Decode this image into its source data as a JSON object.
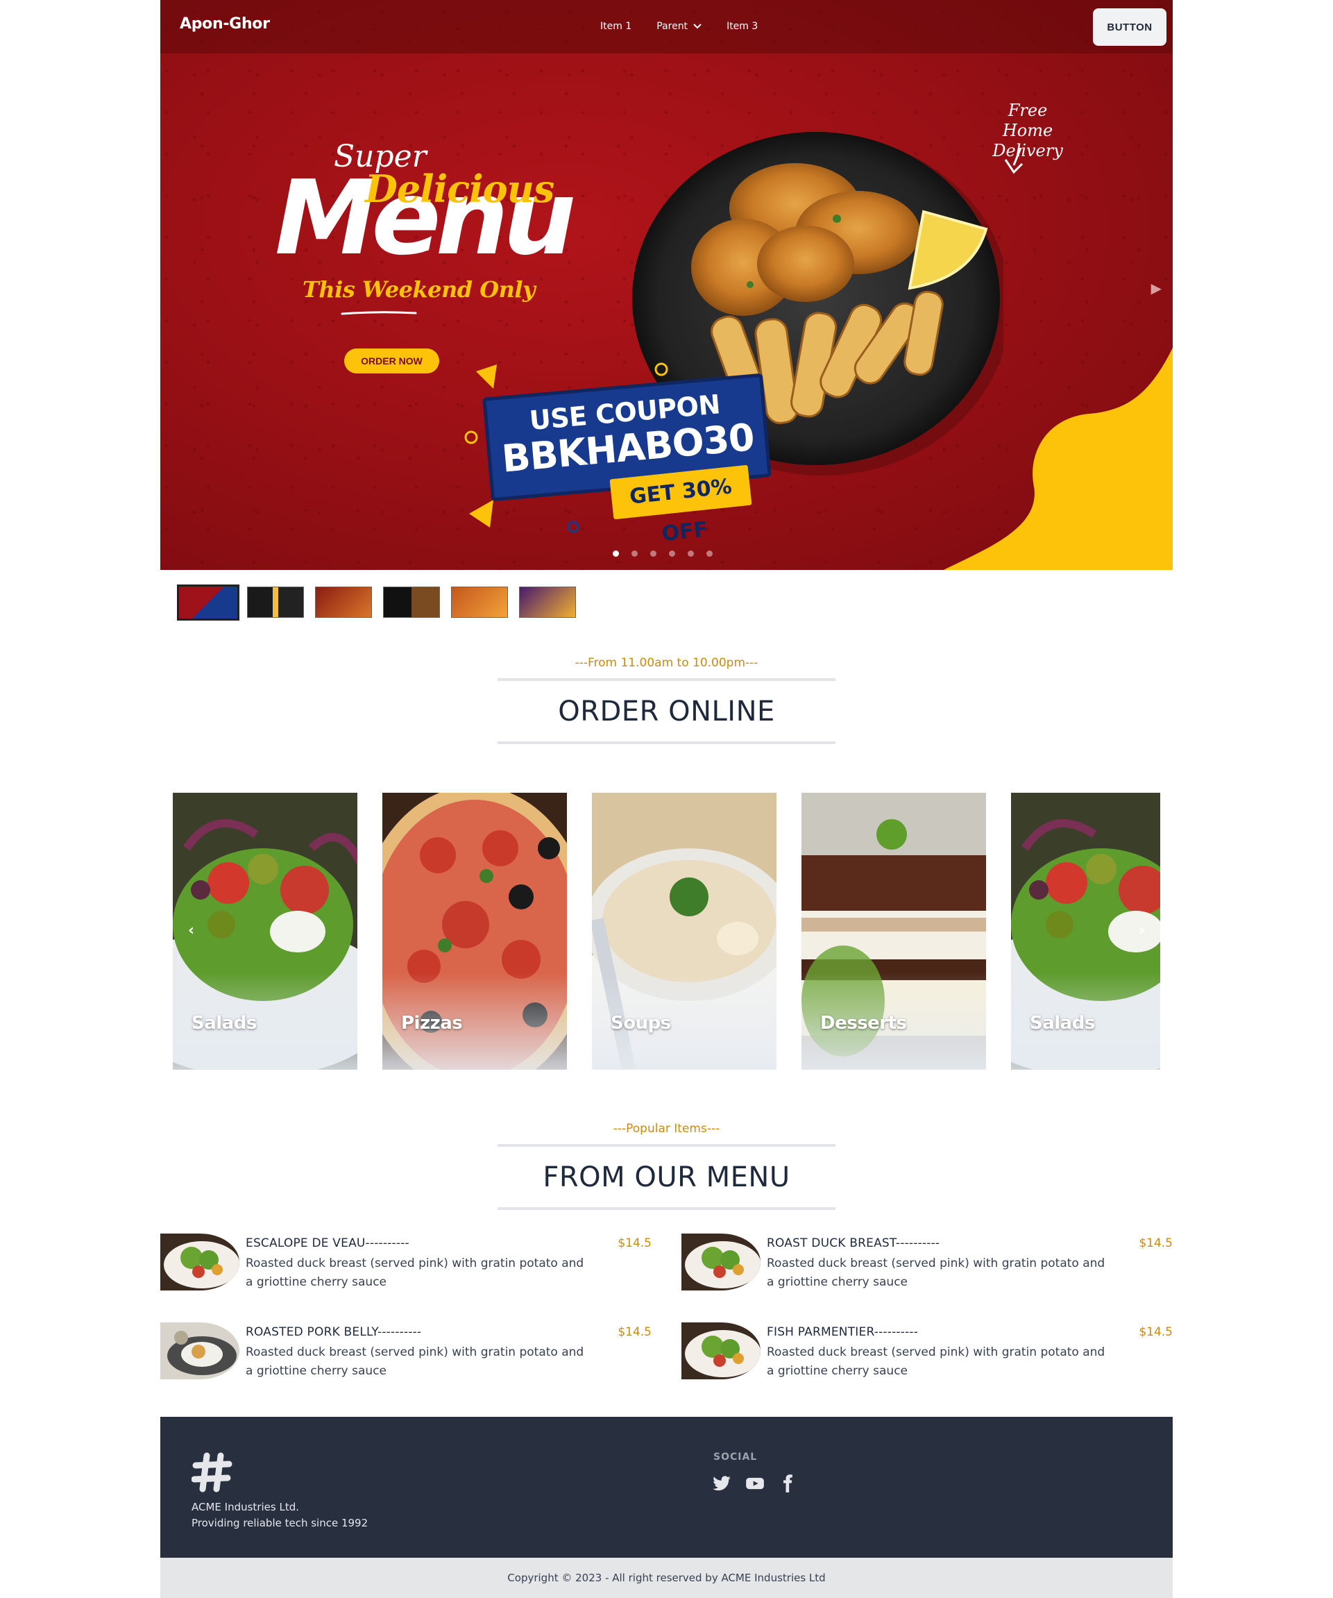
{
  "nav": {
    "brand": "Apon-Ghor",
    "items": [
      {
        "label": "Item 1"
      },
      {
        "label": "Parent"
      },
      {
        "label": "Item 3"
      }
    ],
    "button_label": "BUTTON"
  },
  "hero": {
    "super": "Super",
    "delicious": "Delicious",
    "menu": "Menu",
    "weekend": "This Weekend Only",
    "order_now": "ORDER NOW",
    "free_delivery_line1": "Free Home",
    "free_delivery_line2": "Delivery",
    "coupon_line1": "USE COUPON",
    "coupon_code": "BBKHABO30",
    "coupon_off": "GET 30% OFF",
    "slide_count": 6,
    "active_slide": 1
  },
  "order_section": {
    "sub_label": "---From 11.00am to 10.00pm---",
    "title": "ORDER ONLINE"
  },
  "categories": [
    {
      "label": "Salads"
    },
    {
      "label": "Pizzas"
    },
    {
      "label": "Soups"
    },
    {
      "label": "Desserts"
    },
    {
      "label": "Salads"
    }
  ],
  "menu_section": {
    "sub_label": "---Popular Items---",
    "title": "FROM OUR MENU"
  },
  "menu_items": [
    {
      "name": "ESCALOPE DE VEAU----------",
      "price": "$14.5",
      "desc": "Roasted duck breast (served pink) with gratin potato and a griottine cherry sauce"
    },
    {
      "name": "ROAST DUCK BREAST----------",
      "price": "$14.5",
      "desc": "Roasted duck breast (served pink) with gratin potato and a griottine cherry sauce"
    },
    {
      "name": "ROASTED PORK BELLY----------",
      "price": "$14.5",
      "desc": "Roasted duck breast (served pink) with gratin potato and a griottine cherry sauce"
    },
    {
      "name": "FISH PARMENTIER----------",
      "price": "$14.5",
      "desc": "Roasted duck breast (served pink) with gratin potato and a griottine cherry sauce"
    }
  ],
  "footer": {
    "company_line1": "ACME Industries Ltd.",
    "company_line2": "Providing reliable tech since 1992",
    "social_title": "SOCIAL",
    "social_icons": [
      "twitter-icon",
      "youtube-icon",
      "facebook-icon"
    ],
    "copyright": "Copyright © 2023 - All right reserved by ACME Industries Ltd"
  },
  "colors": {
    "hero_red": "#9a1015",
    "accent_yellow": "#fcc30a",
    "coupon_blue": "#173a8e",
    "gold_text": "#c98b10",
    "footer_bg": "#283040"
  }
}
